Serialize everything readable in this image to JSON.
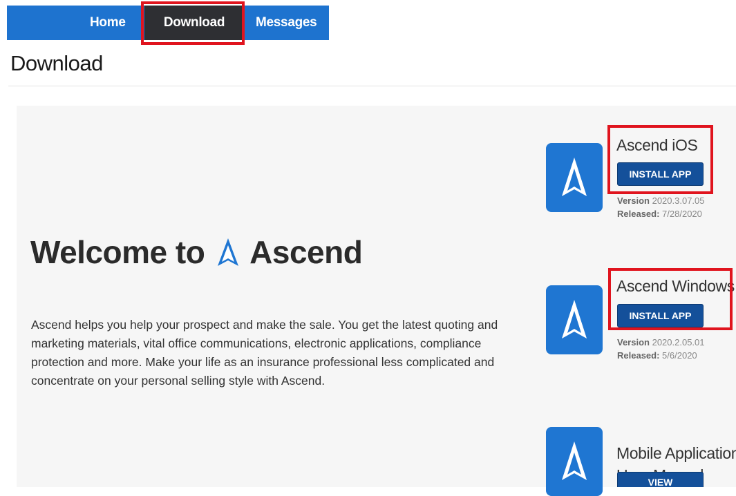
{
  "nav": {
    "items": [
      "Home",
      "Download",
      "Messages"
    ],
    "active": "Download"
  },
  "page": {
    "title": "Download"
  },
  "hero": {
    "welcome_prefix": "Welcome to",
    "brand": "Ascend",
    "description": "Ascend helps you help your prospect and make the sale. You get the latest quoting and marketing materials, vital office communications, electronic applications, compliance protection and more. Make your life as an insurance professional less complicated and concentrate on your personal selling style with Ascend."
  },
  "apps": [
    {
      "name": "Ascend iOS",
      "button": "INSTALL APP",
      "version_label": "Version",
      "version": "2020.3.07.05",
      "released_label": "Released:",
      "released": "7/28/2020"
    },
    {
      "name": "Ascend Windows",
      "button": "INSTALL APP",
      "version_label": "Version",
      "version": "2020.2.05.01",
      "released_label": "Released:",
      "released": "5/6/2020"
    },
    {
      "name_line1": "Mobile Application",
      "name_line2": "User Manual",
      "button": "VIEW"
    }
  ],
  "colors": {
    "nav_bg": "#1e73cf",
    "nav_active_bg": "#2e2f33",
    "highlight": "#e0141e",
    "button_bg": "#14509a",
    "icon_bg": "#1f76d2"
  },
  "icons": {
    "app": "ascend-a-logo-icon"
  }
}
